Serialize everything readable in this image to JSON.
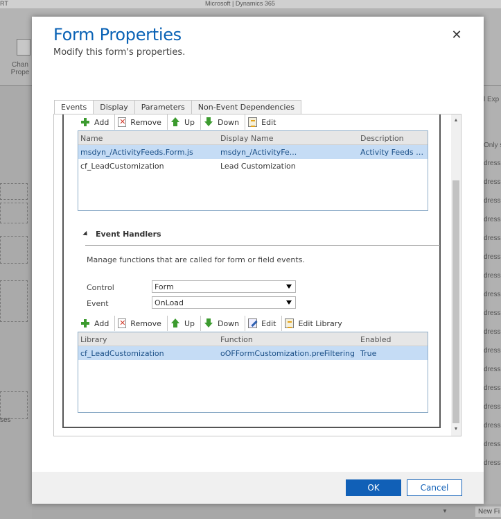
{
  "background": {
    "top_brand": "Microsoft  |  Dynamics 365",
    "top_left": "RT",
    "ribbon_button": "Chan Prope",
    "left_text": "ses",
    "right_title": "l Exp",
    "right_only": "Only s",
    "right_items": [
      "dress",
      "dress",
      "dress",
      "dress",
      "dress",
      "dress",
      "dress",
      "dress",
      "dress",
      "dress",
      "dress",
      "dress",
      "dress",
      "dress",
      "dress",
      "dress",
      "dress"
    ],
    "bottom_new": "New Fi"
  },
  "dialog": {
    "title": "Form Properties",
    "subtitle": "Modify this form's properties.",
    "close_icon": "✕"
  },
  "tabs": [
    {
      "label": "Events",
      "active": true
    },
    {
      "label": "Display",
      "active": false
    },
    {
      "label": "Parameters",
      "active": false
    },
    {
      "label": "Non-Event Dependencies",
      "active": false
    }
  ],
  "libraries_toolbar": {
    "add": "Add",
    "remove": "Remove",
    "up": "Up",
    "down": "Down",
    "edit": "Edit"
  },
  "libraries_grid": {
    "headers": [
      "Name",
      "Display Name",
      "Description"
    ],
    "rows": [
      {
        "name": "msdyn_/ActivityFeeds.Form.js",
        "display_name": "msdyn_/ActivityFe...",
        "description": "Activity Feeds Co...",
        "selected": true
      },
      {
        "name": "cf_LeadCustomization",
        "display_name": "Lead Customization",
        "description": "",
        "selected": false
      }
    ]
  },
  "event_handlers": {
    "section_title": "Event Handlers",
    "description": "Manage functions that are called for form or field events.",
    "control_label": "Control",
    "control_value": "Form",
    "event_label": "Event",
    "event_value": "OnLoad"
  },
  "handlers_toolbar": {
    "add": "Add",
    "remove": "Remove",
    "up": "Up",
    "down": "Down",
    "edit": "Edit",
    "edit_library": "Edit Library"
  },
  "handlers_grid": {
    "headers": [
      "Library",
      "Function",
      "Enabled"
    ],
    "rows": [
      {
        "library": "cf_LeadCustomization",
        "function": "oOFFormCustomization.preFiltering",
        "enabled": "True",
        "selected": true
      }
    ]
  },
  "footer": {
    "ok": "OK",
    "cancel": "Cancel"
  },
  "colors": {
    "accent": "#1160b7",
    "title": "#0a62b5",
    "selected_row": "#c5dcf5"
  }
}
